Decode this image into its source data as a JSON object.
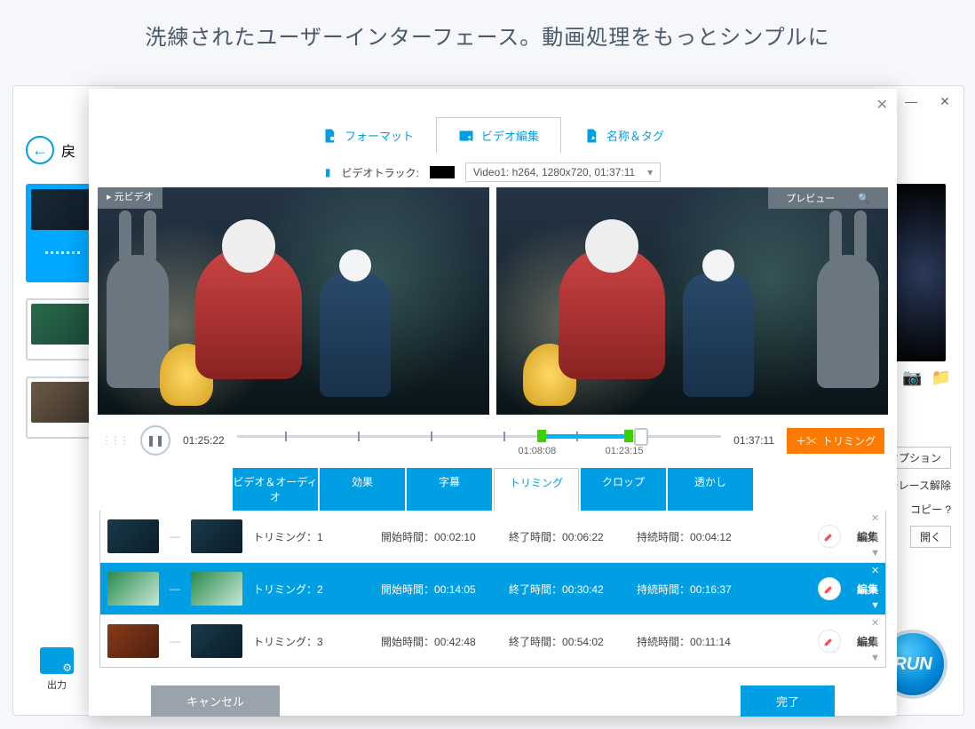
{
  "headline": "洗練されたユーザーインターフェース。動画処理をもっとシンプルに",
  "shell": {
    "back_label": "戻",
    "output_label": "出力",
    "run_label": "RUN",
    "options_label": "オプション",
    "deinterlace_label": "ーレース解除",
    "copy_label": "コピー ?",
    "open_label": "開く"
  },
  "editor": {
    "tabs": {
      "format": "フォーマット",
      "video_edit": "ビデオ編集",
      "name_tag": "名称＆タグ"
    },
    "track_label": "ビデオトラック:",
    "track_value": "Video1: h264, 1280x720, 01:37:11",
    "source_label": "▸ 元ビデオ",
    "preview_label": "プレビュー",
    "timeline": {
      "current": "01:25:22",
      "total": "01:37:11",
      "range_start": "01:08:08",
      "range_end": "01:23:15"
    },
    "trim_button": "トリミング",
    "sub_tabs": {
      "va": "ビデオ＆オーディオ",
      "effect": "効果",
      "subtitle": "字幕",
      "trim": "トリミング",
      "crop": "クロップ",
      "watermark": "透かし"
    },
    "labels": {
      "trim_prefix": "トリミング：",
      "start": "開始時間：",
      "end": "終了時間：",
      "duration": "持続時間：",
      "edit": "編集"
    },
    "rows": [
      {
        "idx": "1",
        "start": "00:02:10",
        "end": "00:06:22",
        "dur": "00:04:12"
      },
      {
        "idx": "2",
        "start": "00:14:05",
        "end": "00:30:42",
        "dur": "00:16:37"
      },
      {
        "idx": "3",
        "start": "00:42:48",
        "end": "00:54:02",
        "dur": "00:11:14"
      }
    ],
    "actions": {
      "cancel": "キャンセル",
      "done": "完了"
    }
  }
}
